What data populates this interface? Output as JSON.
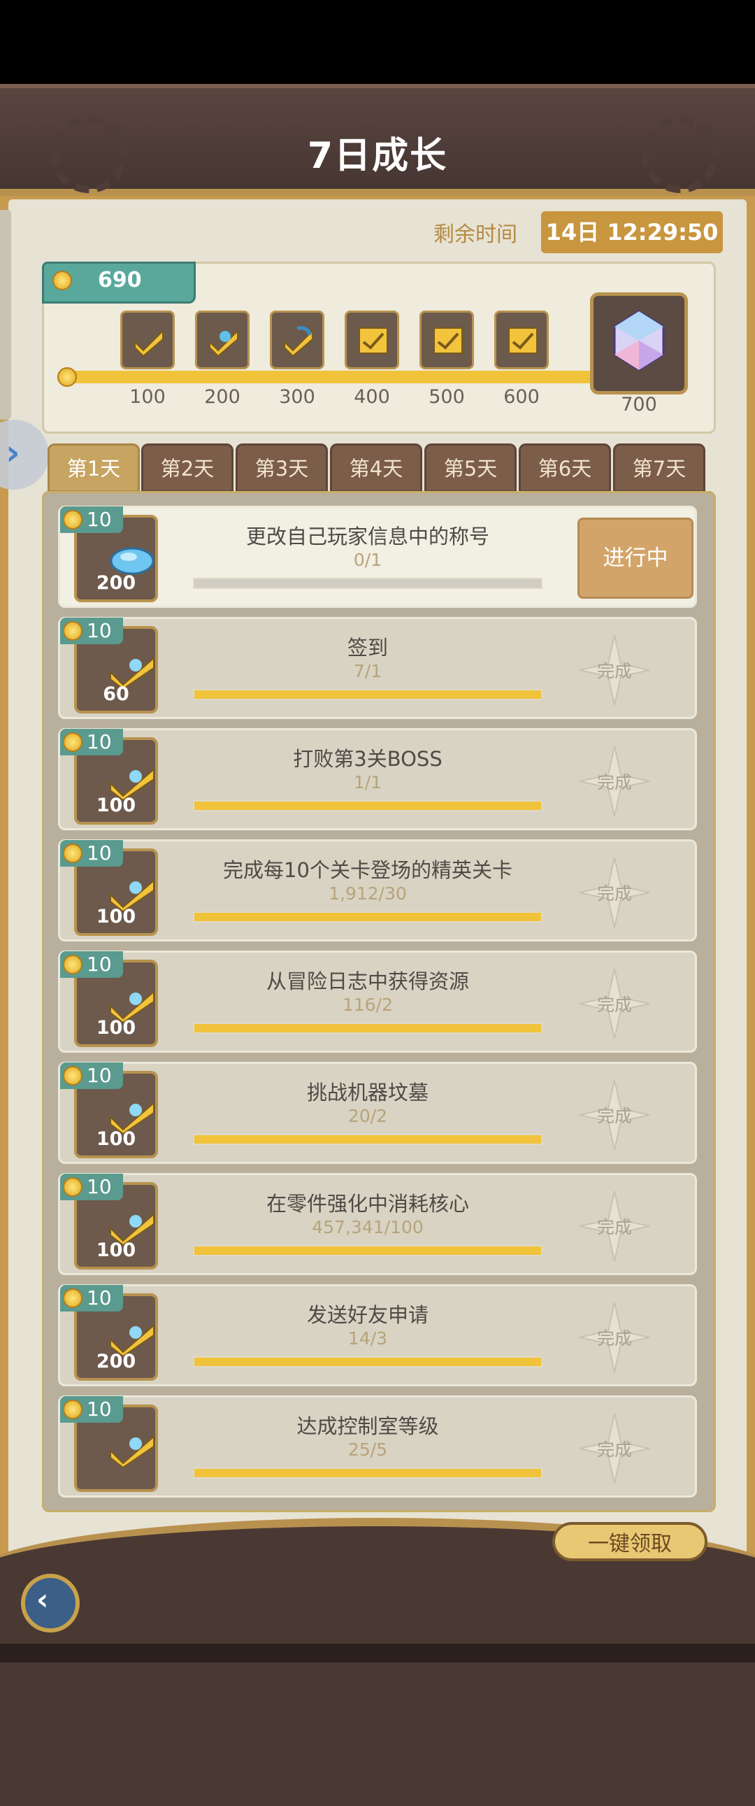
{
  "header": {
    "title": "7日成长"
  },
  "timer": {
    "label": "剩余时间",
    "value": "14日 12:29:50"
  },
  "progress": {
    "points": "690",
    "milestones": [
      "100",
      "200",
      "300",
      "400",
      "500",
      "600"
    ],
    "final_milestone": "700"
  },
  "tabs": [
    "第1天",
    "第2天",
    "第3天",
    "第4天",
    "第5天",
    "第6天",
    "第7天"
  ],
  "active_tab": "第1天",
  "tasks": [
    {
      "points": "10",
      "reward": "200",
      "name": "更改自己玩家信息中的称号",
      "progress": "0/1",
      "status": "进行中"
    },
    {
      "points": "10",
      "reward": "60",
      "name": "签到",
      "progress": "7/1",
      "status": "完成"
    },
    {
      "points": "10",
      "reward": "100",
      "name": "打败第3关BOSS",
      "progress": "1/1",
      "status": "完成"
    },
    {
      "points": "10",
      "reward": "100",
      "name": "完成每10个关卡登场的精英关卡",
      "progress": "1,912/30",
      "status": "完成"
    },
    {
      "points": "10",
      "reward": "100",
      "name": "从冒险日志中获得资源",
      "progress": "116/2",
      "status": "完成"
    },
    {
      "points": "10",
      "reward": "100",
      "name": "挑战机器坟墓",
      "progress": "20/2",
      "status": "完成"
    },
    {
      "points": "10",
      "reward": "100",
      "name": "在零件强化中消耗核心",
      "progress": "457,341/100",
      "status": "完成"
    },
    {
      "points": "10",
      "reward": "200",
      "name": "发送好友申请",
      "progress": "14/3",
      "status": "完成"
    },
    {
      "points": "10",
      "reward": "",
      "name": "达成控制室等级",
      "progress": "25/5",
      "status": "完成"
    }
  ],
  "footer": {
    "claim_all": "一键领取"
  },
  "colors": {
    "accent": "#c8963e",
    "progress": "#f1c33b",
    "teal": "#5aa89c"
  }
}
